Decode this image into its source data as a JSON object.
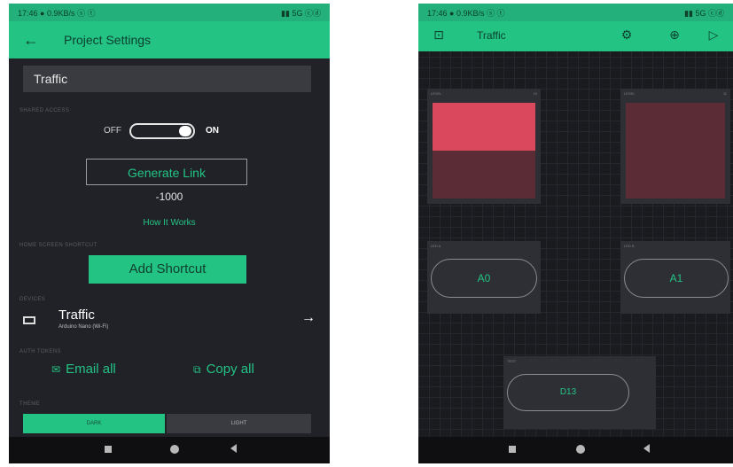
{
  "left": {
    "status": {
      "left": "17:46 ● 0.9KB/s ⓢ ⓣ",
      "right": "▮▮ 5G ⓒⓓ"
    },
    "appbar": {
      "title": "Project Settings",
      "back_icon": "arrow-left-icon"
    },
    "project_name": "Traffic",
    "labels": {
      "share": "SHARED ACCESS",
      "shortcut": "HOME SCREEN SHORTCUT",
      "devices": "DEVICES",
      "auth": "AUTH TOKENS",
      "theme": "THEME"
    },
    "toggle": {
      "off": "OFF",
      "on": "ON",
      "state": true
    },
    "generate_link": "Generate Link",
    "counter": "-1000",
    "how_it_works": "How It Works",
    "add_shortcut": "Add Shortcut",
    "device": {
      "name": "Traffic",
      "sub": "Arduino Nano (Wi-Fi)"
    },
    "email_all": "Email all",
    "copy_all": "Copy all",
    "theme": {
      "dark": "DARK",
      "light": "LIGHT"
    }
  },
  "right": {
    "status": {
      "left": "17:46 ● 0.9KB/s ⓢ ⓣ",
      "right": "▮▮ 5G ⓒⓓ"
    },
    "appbar": {
      "title": "Traffic"
    },
    "level1": {
      "label": "LEVEL",
      "value_label": "10",
      "level": 0.5
    },
    "level2": {
      "label": "LEVEL",
      "value_label": "11",
      "level": 0.0
    },
    "btn_a0": {
      "label": "LED A",
      "value": "A0"
    },
    "btn_a1": {
      "label": "LED B",
      "value": "A1"
    },
    "btn_d13": {
      "label": "TEST",
      "value": "D13"
    },
    "colors": {
      "accent": "#23c384",
      "level_on": "#d9485c",
      "level_off": "#5c2c36"
    }
  }
}
